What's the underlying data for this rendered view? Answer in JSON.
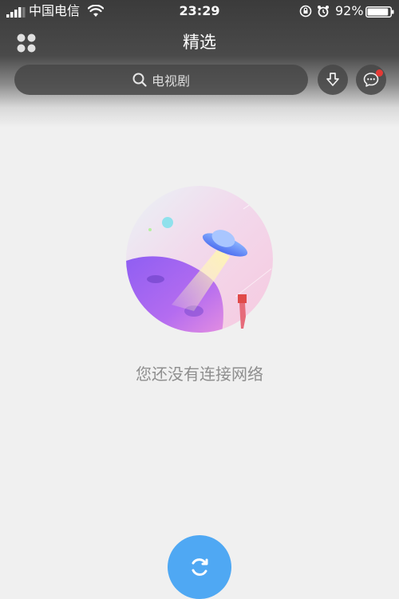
{
  "status_bar": {
    "carrier": "中国电信",
    "time": "23:29",
    "battery_percent": "92%",
    "battery_level": 0.92,
    "icons": [
      "signal-icon",
      "wifi-icon",
      "rotation-lock-icon",
      "alarm-icon",
      "battery-icon"
    ]
  },
  "nav": {
    "title": "精选",
    "left_icon": "grid-menu-icon"
  },
  "search": {
    "placeholder": "电视剧",
    "icon": "search-icon"
  },
  "actions": {
    "download_icon": "download-icon",
    "message_icon": "message-icon",
    "has_notification": true
  },
  "empty_state": {
    "message": "您还没有连接网络",
    "illustration": "ufo-planet-illustration"
  },
  "refresh": {
    "icon": "refresh-icon"
  },
  "colors": {
    "accent": "#4fa8f3",
    "notification": "#e53935",
    "background": "#f0f0f0"
  }
}
